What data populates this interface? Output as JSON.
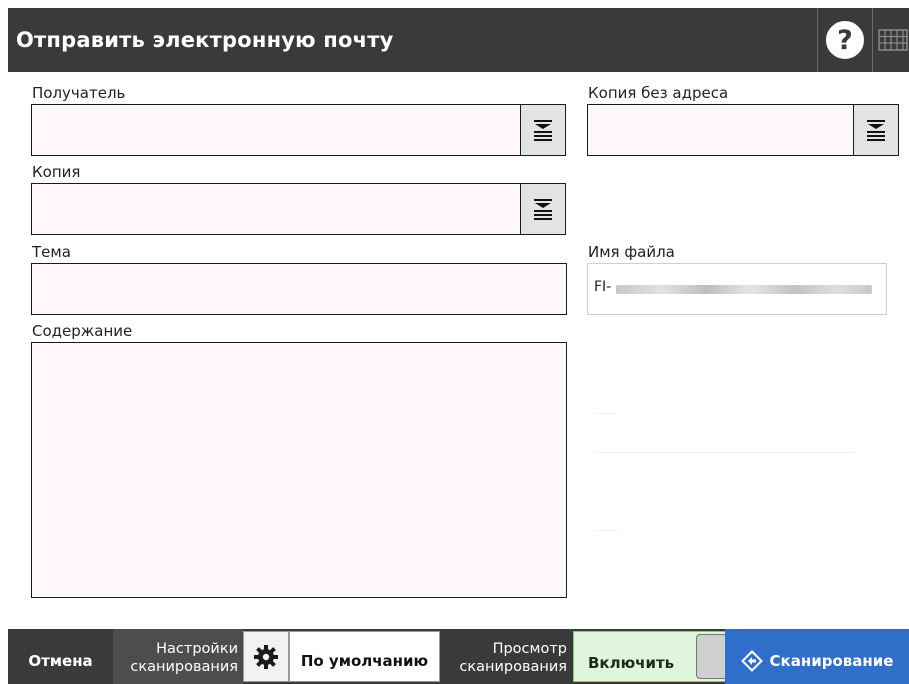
{
  "header": {
    "title": "Отправить электронную почту",
    "help_label": "?",
    "help_icon": "question-icon",
    "keyboard_icon": "keyboard-icon"
  },
  "form": {
    "to_label": "Получатель",
    "to_value": "",
    "cc_label": "Копия",
    "cc_value": "",
    "bcc_label": "Копия без адреса",
    "bcc_value": "",
    "subject_label": "Тема",
    "subject_value": "",
    "filename_label": "Имя файла",
    "filename_prefix": "FI-",
    "body_label": "Содержание",
    "body_value": "",
    "address_list_icon": "address-list-icon"
  },
  "footer": {
    "cancel_label": "Отмена",
    "scan_settings_line1": "Настройки",
    "scan_settings_line2": "сканирования",
    "gear_icon": "gear-icon",
    "default_label": "По умолчанию",
    "preview_line1": "Просмотр",
    "preview_line2": "сканирования",
    "enable_label": "Включить",
    "scan_label": "Сканирование",
    "scan_icon": "diamond-arrow-icon"
  },
  "colors": {
    "header_bg": "#3a3a3a",
    "field_bg": "#fff7f8",
    "enable_bg": "#dff5dc",
    "scan_bg": "#2f6fc9"
  }
}
